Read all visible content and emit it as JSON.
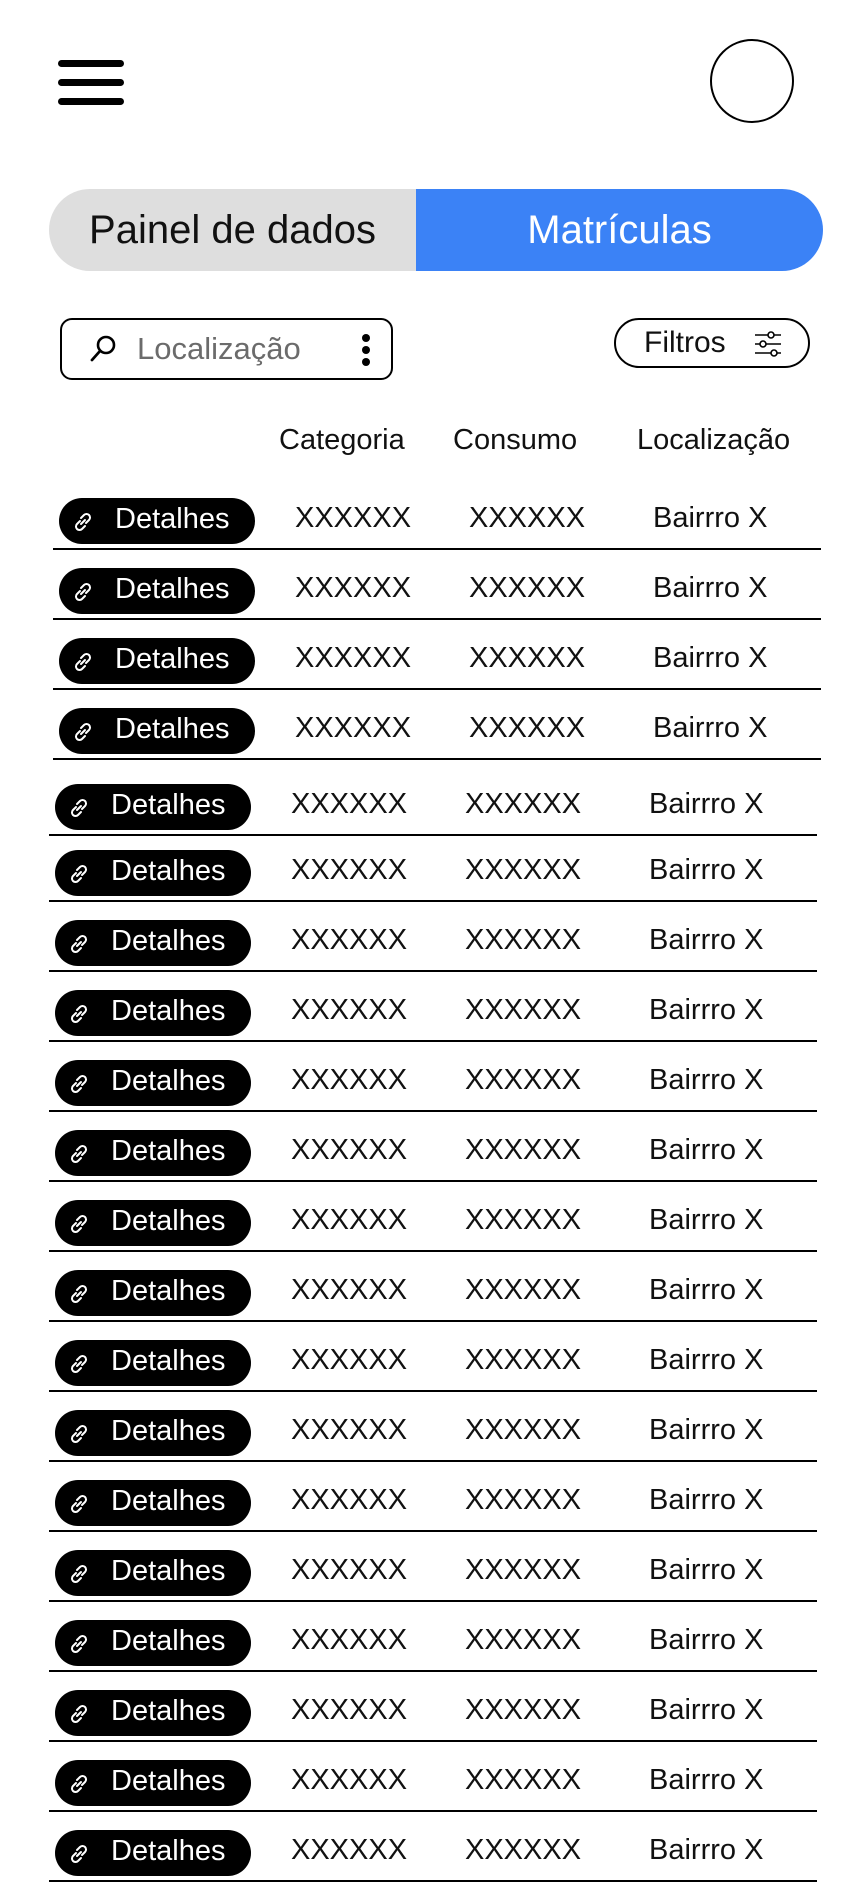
{
  "header": {
    "menu_icon": "hamburger-menu-icon",
    "avatar_icon": "profile-avatar"
  },
  "tabs": [
    {
      "label": "Painel de dados",
      "active": false
    },
    {
      "label": "Matrículas",
      "active": true
    }
  ],
  "colors": {
    "accent": "#3b82f6",
    "tab_inactive": "#dedede",
    "button_bg": "#000000"
  },
  "search": {
    "placeholder": "Localização",
    "value": ""
  },
  "filters": {
    "label": "Filtros",
    "icon": "sliders-icon"
  },
  "table": {
    "columns": [
      "Categoria",
      "Consumo",
      "Localização"
    ],
    "details_label": "Detalhes",
    "details_icon": "link-icon",
    "rows": [
      {
        "categoria": "XXXXXX",
        "consumo": "XXXXXX",
        "localizacao": "Bairrro X"
      },
      {
        "categoria": "XXXXXX",
        "consumo": "XXXXXX",
        "localizacao": "Bairrro X"
      },
      {
        "categoria": "XXXXXX",
        "consumo": "XXXXXX",
        "localizacao": "Bairrro X"
      },
      {
        "categoria": "XXXXXX",
        "consumo": "XXXXXX",
        "localizacao": "Bairrro X"
      },
      {
        "categoria": "XXXXXX",
        "consumo": "XXXXXX",
        "localizacao": "Bairrro X"
      },
      {
        "categoria": "XXXXXX",
        "consumo": "XXXXXX",
        "localizacao": "Bairrro X"
      },
      {
        "categoria": "XXXXXX",
        "consumo": "XXXXXX",
        "localizacao": "Bairrro X"
      },
      {
        "categoria": "XXXXXX",
        "consumo": "XXXXXX",
        "localizacao": "Bairrro X"
      },
      {
        "categoria": "XXXXXX",
        "consumo": "XXXXXX",
        "localizacao": "Bairrro X"
      },
      {
        "categoria": "XXXXXX",
        "consumo": "XXXXXX",
        "localizacao": "Bairrro X"
      },
      {
        "categoria": "XXXXXX",
        "consumo": "XXXXXX",
        "localizacao": "Bairrro X"
      },
      {
        "categoria": "XXXXXX",
        "consumo": "XXXXXX",
        "localizacao": "Bairrro X"
      },
      {
        "categoria": "XXXXXX",
        "consumo": "XXXXXX",
        "localizacao": "Bairrro X"
      },
      {
        "categoria": "XXXXXX",
        "consumo": "XXXXXX",
        "localizacao": "Bairrro X"
      },
      {
        "categoria": "XXXXXX",
        "consumo": "XXXXXX",
        "localizacao": "Bairrro X"
      },
      {
        "categoria": "XXXXXX",
        "consumo": "XXXXXX",
        "localizacao": "Bairrro X"
      },
      {
        "categoria": "XXXXXX",
        "consumo": "XXXXXX",
        "localizacao": "Bairrro X"
      },
      {
        "categoria": "XXXXXX",
        "consumo": "XXXXXX",
        "localizacao": "Bairrro X"
      },
      {
        "categoria": "XXXXXX",
        "consumo": "XXXXXX",
        "localizacao": "Bairrro X"
      },
      {
        "categoria": "XXXXXX",
        "consumo": "XXXXXX",
        "localizacao": "Bairrro X"
      }
    ]
  }
}
